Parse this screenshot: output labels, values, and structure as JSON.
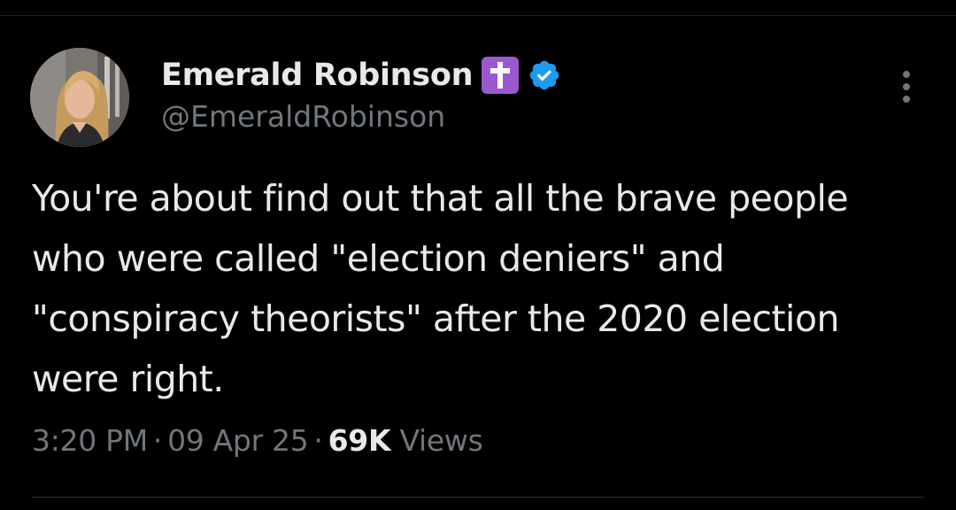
{
  "tweet": {
    "author": {
      "display_name": "Emerald Robinson",
      "handle": "@EmeraldRobinson",
      "badges": [
        "latin-cross-emoji",
        "verified-badge"
      ],
      "verified_color": "#1d9bf0",
      "cross_emoji_color": "#9b59d0"
    },
    "text": "You're about find out that all the brave people who were called \"election deniers\" and \"conspiracy theorists\" after the 2020 election were right.",
    "meta": {
      "time": "3:20 PM",
      "separator": "·",
      "date": "09 Apr 25",
      "views_count": "69K",
      "views_label": "Views"
    },
    "more_icon": "more-vertical-icon"
  },
  "colors": {
    "background": "#000000",
    "text_primary": "#e7e9ea",
    "text_secondary": "#71767b",
    "divider": "#2f3336"
  }
}
